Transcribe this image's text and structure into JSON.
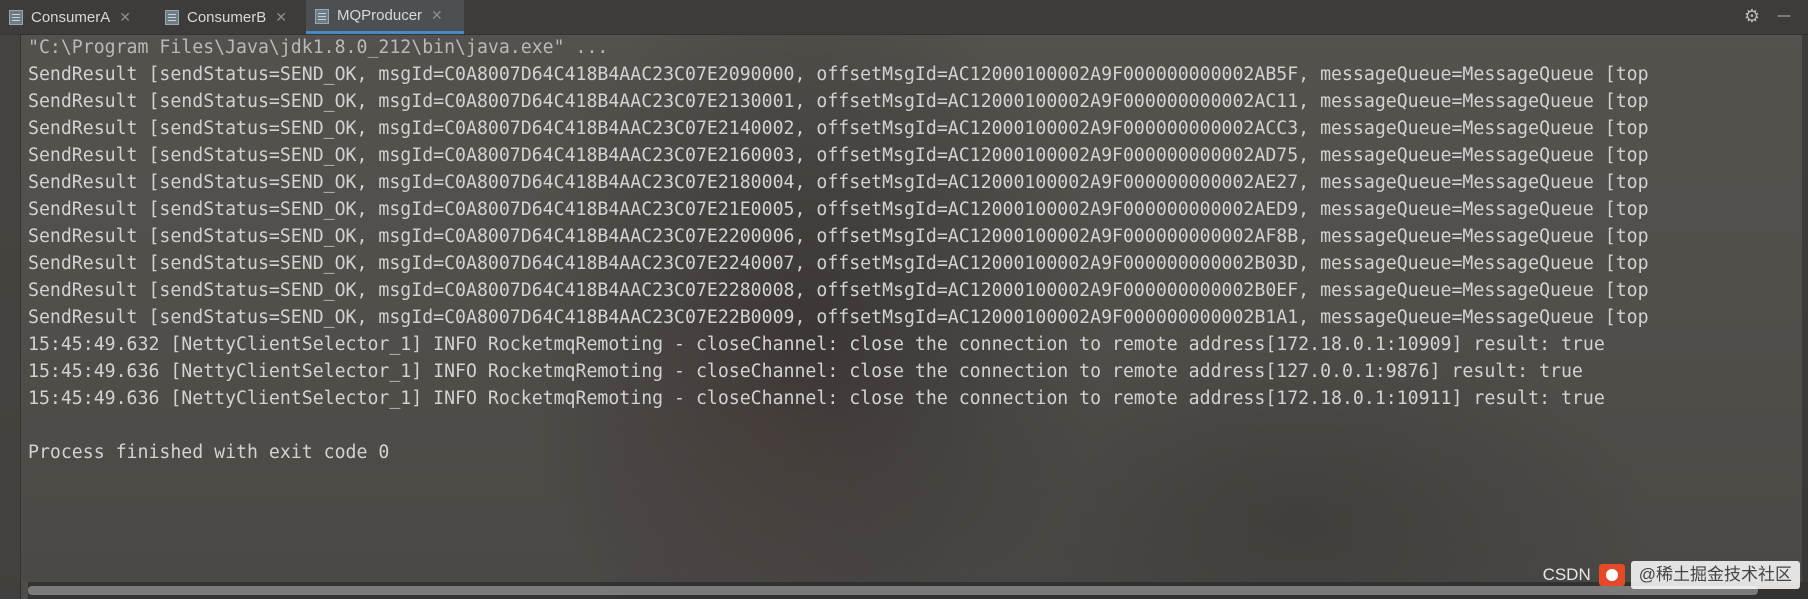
{
  "tabs": [
    {
      "label": "ConsumerA",
      "active": false
    },
    {
      "label": "ConsumerB",
      "active": false
    },
    {
      "label": "MQProducer",
      "active": true
    }
  ],
  "toolbar": {
    "settings_icon": "gear-icon",
    "hide_icon": "minimize-icon"
  },
  "console": {
    "lines": [
      "\"C:\\Program Files\\Java\\jdk1.8.0_212\\bin\\java.exe\" ...",
      "SendResult [sendStatus=SEND_OK, msgId=C0A8007D64C418B4AAC23C07E2090000, offsetMsgId=AC12000100002A9F000000000002AB5F, messageQueue=MessageQueue [top",
      "SendResult [sendStatus=SEND_OK, msgId=C0A8007D64C418B4AAC23C07E2130001, offsetMsgId=AC12000100002A9F000000000002AC11, messageQueue=MessageQueue [top",
      "SendResult [sendStatus=SEND_OK, msgId=C0A8007D64C418B4AAC23C07E2140002, offsetMsgId=AC12000100002A9F000000000002ACC3, messageQueue=MessageQueue [top",
      "SendResult [sendStatus=SEND_OK, msgId=C0A8007D64C418B4AAC23C07E2160003, offsetMsgId=AC12000100002A9F000000000002AD75, messageQueue=MessageQueue [top",
      "SendResult [sendStatus=SEND_OK, msgId=C0A8007D64C418B4AAC23C07E2180004, offsetMsgId=AC12000100002A9F000000000002AE27, messageQueue=MessageQueue [top",
      "SendResult [sendStatus=SEND_OK, msgId=C0A8007D64C418B4AAC23C07E21E0005, offsetMsgId=AC12000100002A9F000000000002AED9, messageQueue=MessageQueue [top",
      "SendResult [sendStatus=SEND_OK, msgId=C0A8007D64C418B4AAC23C07E2200006, offsetMsgId=AC12000100002A9F000000000002AF8B, messageQueue=MessageQueue [top",
      "SendResult [sendStatus=SEND_OK, msgId=C0A8007D64C418B4AAC23C07E2240007, offsetMsgId=AC12000100002A9F000000000002B03D, messageQueue=MessageQueue [top",
      "SendResult [sendStatus=SEND_OK, msgId=C0A8007D64C418B4AAC23C07E2280008, offsetMsgId=AC12000100002A9F000000000002B0EF, messageQueue=MessageQueue [top",
      "SendResult [sendStatus=SEND_OK, msgId=C0A8007D64C418B4AAC23C07E22B0009, offsetMsgId=AC12000100002A9F000000000002B1A1, messageQueue=MessageQueue [top",
      "15:45:49.632 [NettyClientSelector_1] INFO RocketmqRemoting - closeChannel: close the connection to remote address[172.18.0.1:10909] result: true",
      "15:45:49.636 [NettyClientSelector_1] INFO RocketmqRemoting - closeChannel: close the connection to remote address[127.0.0.1:9876] result: true",
      "15:45:49.636 [NettyClientSelector_1] INFO RocketmqRemoting - closeChannel: close the connection to remote address[172.18.0.1:10911] result: true",
      "",
      "Process finished with exit code 0"
    ]
  },
  "watermark": {
    "text": "CSDN",
    "tail": "@稀土掘金技术社区"
  },
  "colors": {
    "text": "#d2d2d2",
    "tab_accent": "#4a88c7",
    "watermark_badge": "#e24a2a"
  }
}
